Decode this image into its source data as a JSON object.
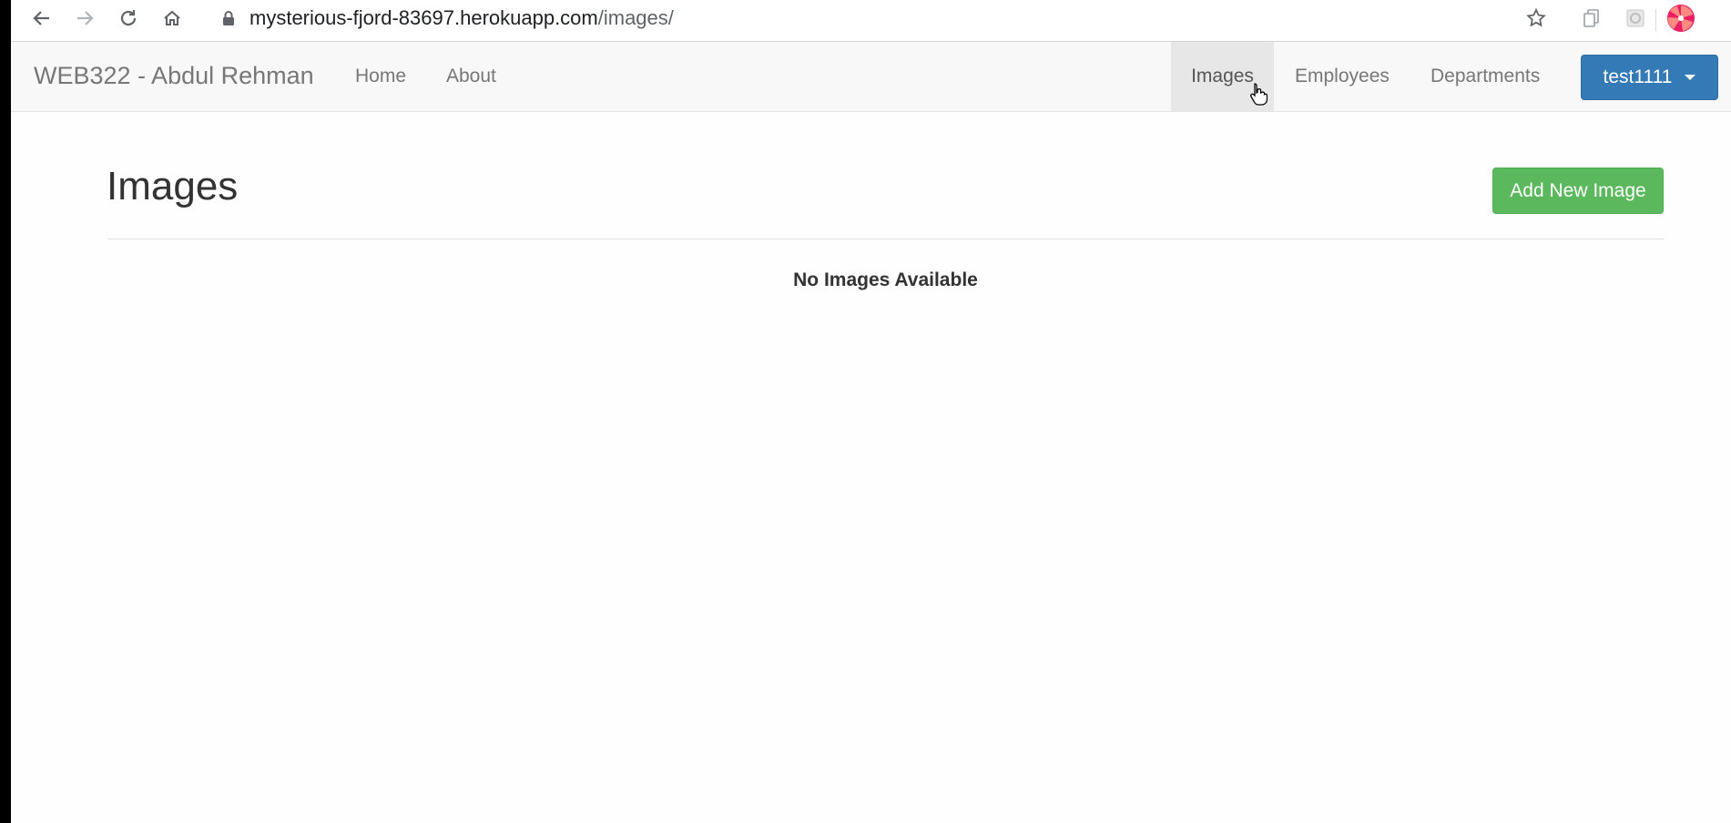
{
  "browser": {
    "url_host": "mysterious-fjord-83697.herokuapp.com",
    "url_path": "/images/",
    "icons": [
      "back-icon",
      "forward-icon",
      "reload-icon",
      "home-icon",
      "lock-icon",
      "star-icon",
      "extension-icon",
      "extension-icon",
      "profile-avatar"
    ]
  },
  "navbar": {
    "brand": "WEB322 - Abdul Rehman",
    "left_links": [
      "Home",
      "About"
    ],
    "right_links": [
      "Images",
      "Employees",
      "Departments"
    ],
    "active": "Images",
    "user_button": "test1111"
  },
  "main": {
    "title": "Images",
    "add_button": "Add New Image",
    "empty_message": "No Images Available"
  },
  "colors": {
    "primary": "#337ab7",
    "success": "#5cb85c",
    "navbar_bg": "#f8f8f8",
    "active_nav_bg": "#e7e7e7"
  }
}
